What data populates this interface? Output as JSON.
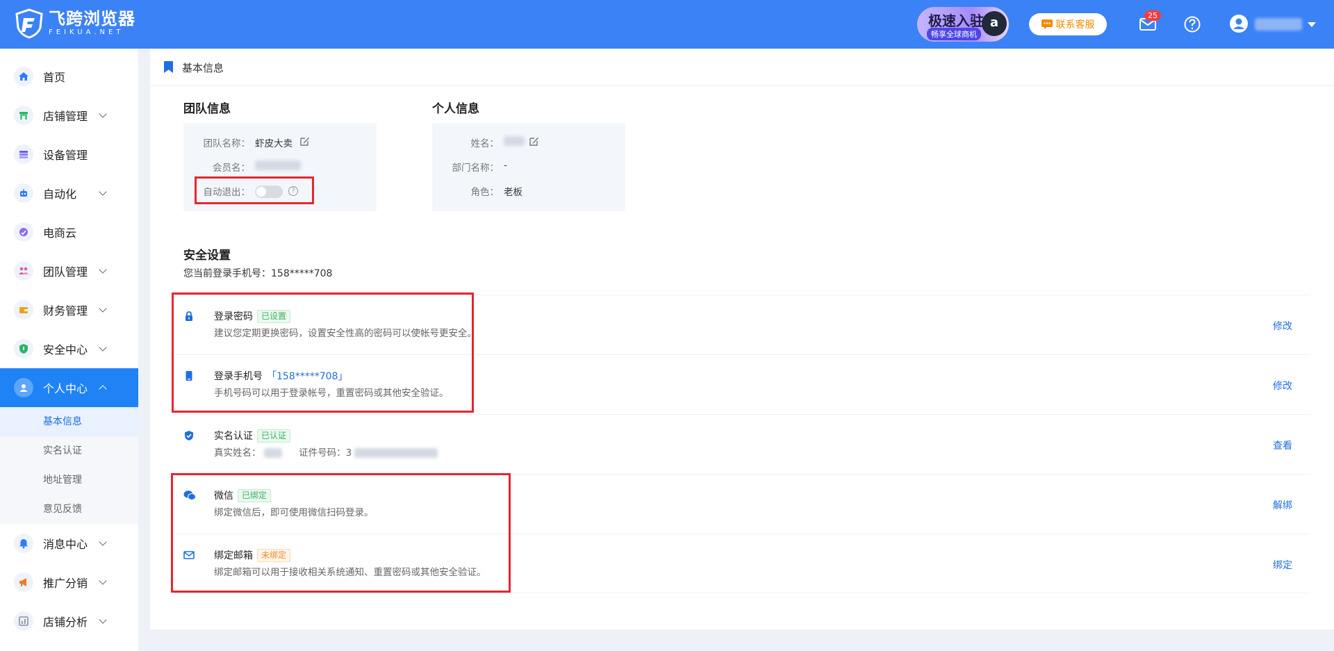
{
  "brand": {
    "name_cn": "飞跨浏览器",
    "name_en": "FEIKUA.NET"
  },
  "header": {
    "promo_main": "极速入驻",
    "promo_sub": "畅享全球商机",
    "promo_badge": "a",
    "service_label": "联系客服",
    "mail_count": "25"
  },
  "sidebar": {
    "items": [
      {
        "label": "首页"
      },
      {
        "label": "店铺管理"
      },
      {
        "label": "设备管理"
      },
      {
        "label": "自动化"
      },
      {
        "label": "电商云"
      },
      {
        "label": "团队管理"
      },
      {
        "label": "财务管理"
      },
      {
        "label": "安全中心"
      },
      {
        "label": "个人中心"
      },
      {
        "label": "消息中心"
      },
      {
        "label": "推广分销"
      },
      {
        "label": "店铺分析"
      }
    ],
    "sub_items": [
      {
        "label": "基本信息"
      },
      {
        "label": "实名认证"
      },
      {
        "label": "地址管理"
      },
      {
        "label": "意见反馈"
      }
    ]
  },
  "page": {
    "title": "基本信息",
    "team": {
      "section_title": "团队信息",
      "team_name_label": "团队名称：",
      "team_name": "虾皮大卖",
      "member_label": "会员名：",
      "auto_logout_label": "自动退出：",
      "auto_logout_on": false
    },
    "personal": {
      "section_title": "个人信息",
      "name_label": "姓名：",
      "dept_label": "部门名称：",
      "dept_value": "-",
      "role_label": "角色：",
      "role_value": "老板"
    },
    "security": {
      "section_title": "安全设置",
      "phone_line": "您当前登录手机号：158*****708",
      "rows": [
        {
          "title": "登录密码",
          "tag": "已设置",
          "desc": "建议您定期更换密码，设置安全性高的密码可以使帐号更安全。",
          "action": "修改"
        },
        {
          "title": "登录手机号",
          "phone": "「158*****708」",
          "desc": "手机号码可以用于登录帐号，重置密码或其他安全验证。",
          "action": "修改"
        },
        {
          "title": "实名认证",
          "tag": "已认证",
          "real_name_label": "真实姓名：",
          "id_label": "证件号码：",
          "id_prefix": "3",
          "action": "查看"
        },
        {
          "title": "微信",
          "tag": "已绑定",
          "desc": "绑定微信后，即可使用微信扫码登录。",
          "action": "解绑"
        },
        {
          "title": "绑定邮箱",
          "tag": "未绑定",
          "desc": "绑定邮箱可以用于接收相关系统通知、重置密码或其他安全验证。",
          "action": "绑定"
        }
      ]
    }
  },
  "colors": {
    "header": "#3b82f6",
    "accent": "#1f6fe0",
    "highlight": "#e5262f"
  }
}
